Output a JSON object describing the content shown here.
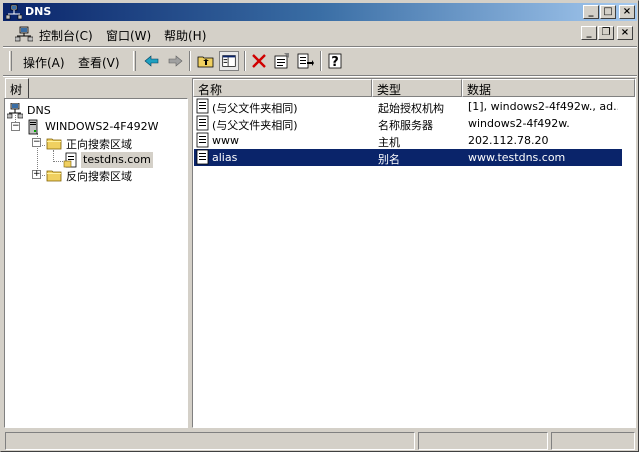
{
  "window": {
    "title": "DNS",
    "controls": {
      "minimize": "_",
      "maximize": "□",
      "close": "×"
    },
    "mdi_controls": {
      "minimize": "_",
      "restore": "❐",
      "close": "×"
    }
  },
  "menubar": {
    "items": [
      {
        "label": "控制台(C)"
      },
      {
        "label": "窗口(W)"
      },
      {
        "label": "帮助(H)"
      }
    ]
  },
  "toolbar": {
    "action_label": "操作(A)",
    "view_label": "查看(V)"
  },
  "tree": {
    "tab_label": "树",
    "nodes": [
      {
        "label": "DNS"
      },
      {
        "label": "WINDOWS2-4F492W"
      },
      {
        "label": "正向搜索区域"
      },
      {
        "label": "testdns.com"
      },
      {
        "label": "反向搜索区域"
      }
    ]
  },
  "list": {
    "columns": [
      {
        "label": "名称"
      },
      {
        "label": "类型"
      },
      {
        "label": "数据"
      }
    ],
    "rows": [
      {
        "name": "(与父文件夹相同)",
        "type": "起始授权机构",
        "data": "[1], windows2-4f492w., ad..."
      },
      {
        "name": "(与父文件夹相同)",
        "type": "名称服务器",
        "data": "windows2-4f492w."
      },
      {
        "name": "www",
        "type": "主机",
        "data": "202.112.78.20"
      },
      {
        "name": "alias",
        "type": "别名",
        "data": "www.testdns.com"
      }
    ],
    "selected_row": 3
  },
  "colors": {
    "selection": "#0a246a",
    "face": "#d4d0c8",
    "title_gradient_start": "#0a246a",
    "title_gradient_end": "#a6caf0"
  }
}
